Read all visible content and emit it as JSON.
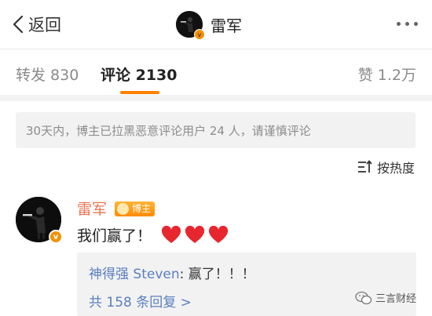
{
  "nav": {
    "back_label": "返回",
    "title": "雷军"
  },
  "tabs": {
    "forward": "转发 830",
    "comments": "评论 2130",
    "likes": "赞 1.2万"
  },
  "notice": "30天内，博主已拉黑恶意评论用户 24 人，请谨慎评论",
  "sort_label": "按热度",
  "comment": {
    "author": "雷军",
    "badge": "博主",
    "verified_mark": "v",
    "text": "我们赢了！",
    "hearts": 3,
    "reply": {
      "author": "神得强 Steven",
      "text": ": 赢了！！！"
    },
    "more_replies": "共 158 条回复 >"
  },
  "watermark": "三言财经",
  "colors": {
    "accent": "#ff8200",
    "name": "#eb7350",
    "link": "#5b7fbf",
    "heart": "#e8262e"
  }
}
